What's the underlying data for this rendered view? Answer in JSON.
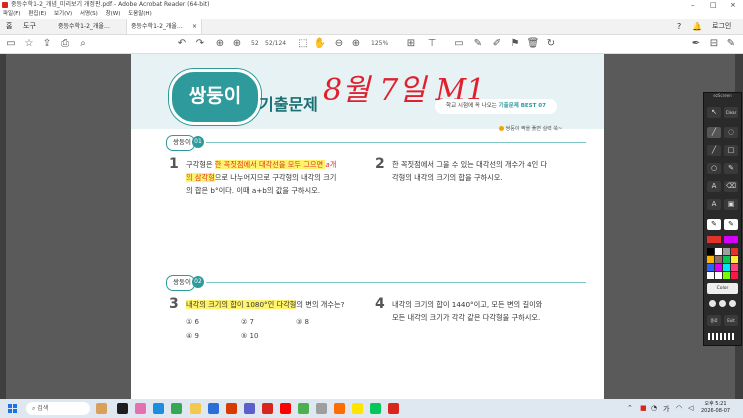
{
  "window": {
    "title": "중등수학1-2_개념_미리보기 개정판.pdf - Adobe Acrobat Reader (64-bit)",
    "controls": [
      "–",
      "□",
      "×"
    ]
  },
  "menu": [
    "파일(F)",
    "편집(E)",
    "보기(V)",
    "서명(S)",
    "창(W)",
    "도움말(H)"
  ],
  "tabs": {
    "home": "홈",
    "tools": "도구",
    "doc1": "중등수학1-2_개울…",
    "doc2": "중등수학1-2_개울…",
    "close": "×",
    "login": "로그인"
  },
  "toolbar": {
    "page_current": "52",
    "page_total": "52/124",
    "zoom": "125%"
  },
  "page": {
    "banner_badge": "쌍둥이",
    "banner_title": "기출문제",
    "handwriting": "8월 7일  M1",
    "banner_pill_prefix": "학교 시험에 꼭 나오는",
    "banner_pill_bold": "기출문제 BEST 07",
    "tip": "쌍둥이 짝을 풀면 실력 쑥~",
    "section1": {
      "label": "쌍둥이",
      "num": "01"
    },
    "section2": {
      "label": "쌍둥이",
      "num": "02"
    },
    "q1": {
      "num": "1",
      "line1_a": "구각형은 ",
      "line1_hl": "한 꼭짓점에서 대각선을 모두 그으면 ",
      "line1_var": "a",
      "line1_end": "개",
      "line2_hl": "의 삼각형",
      "line2_end": "으로 나누어지므로 구각형의 내각의 크기",
      "line3": "의 합은 b°이다. 이때 a+b의 값을 구하시오."
    },
    "q2": {
      "num": "2",
      "line1": "한 꼭짓점에서 그을 수 있는 대각선의 개수가 4인 다",
      "line2": "각형의 내각의 크기의 합을 구하시오."
    },
    "q3": {
      "num": "3",
      "text_hl": "내각의 크기의 합이 1080°인 다각형",
      "text_end": "의 변의 개수는?",
      "choices": [
        "① 6",
        "② 7",
        "③ 8",
        "④ 9",
        "⑤ 10"
      ]
    },
    "q4": {
      "num": "4",
      "line1": "내각의 크기의 합이 1440°이고, 모든 변의 길이와",
      "line2": "모든 내각의 크기가 각각 같은 다각형을 구하시오."
    }
  },
  "palette": {
    "header": "ezScreen",
    "clear": "Clear",
    "color_label": "Color",
    "quit": "종료",
    "exit": "Exit",
    "swatches": [
      "#000000",
      "#ffffff",
      "#9e9e9e",
      "#e0332a",
      "#ffb300",
      "#8d6e63",
      "#00c853",
      "#ffeb3b",
      "#2962ff",
      "#d500f9",
      "#00e5ff",
      "#ff4081",
      "#ffffff",
      "#ffffff",
      "#76ff03",
      "#ff1744"
    ]
  },
  "taskbar": {
    "search": "검색",
    "time": "오후 5:21",
    "date": "2026-08-07"
  }
}
